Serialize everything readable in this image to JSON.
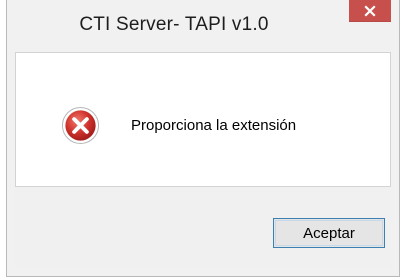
{
  "window": {
    "title": "CTI Server- TAPI  v1.0",
    "close_icon": "close-icon"
  },
  "dialog": {
    "icon": "error-icon",
    "message": "Proporciona la extensión"
  },
  "buttons": {
    "ok_label": "Aceptar"
  },
  "colors": {
    "close_button": "#c7504c",
    "error_icon": "#c62a2a",
    "button_border": "#3c7fb1"
  }
}
